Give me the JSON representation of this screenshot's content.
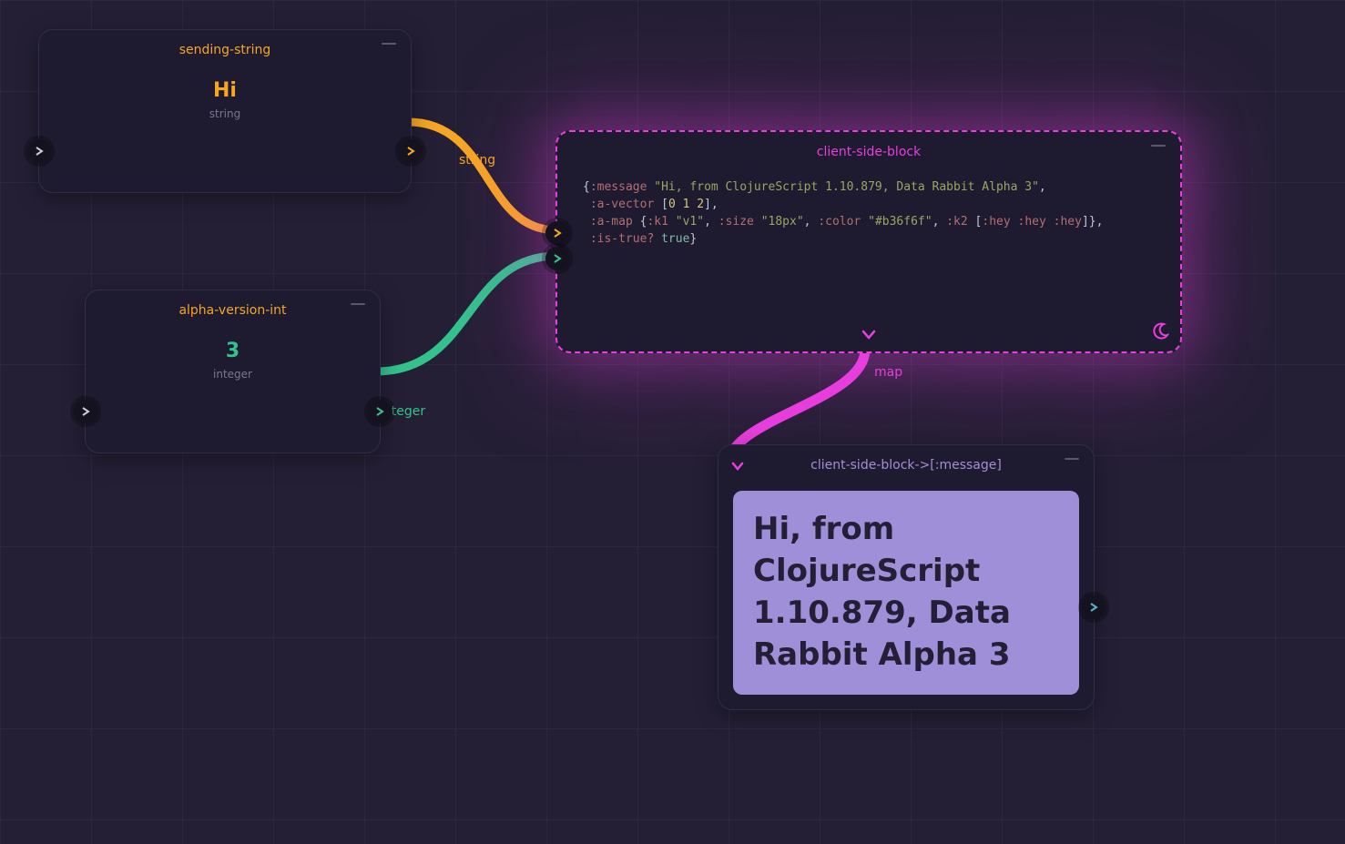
{
  "nodes": {
    "sending_string": {
      "title": "sending-string",
      "value": "Hi",
      "type_label": "string"
    },
    "alpha_version_int": {
      "title": "alpha-version-int",
      "value": "3",
      "type_label": "integer"
    },
    "client_side_block": {
      "title": "client-side-block",
      "code_tokens": [
        [
          [
            "cp",
            "{"
          ],
          [
            "ck",
            ":message"
          ],
          [
            "cp",
            " "
          ],
          [
            "cs",
            "\"Hi, from ClojureScript 1.10.879, Data Rabbit Alpha 3\""
          ],
          [
            "cp",
            ","
          ]
        ],
        [
          [
            "cp",
            " "
          ],
          [
            "ck",
            ":a-vector"
          ],
          [
            "cp",
            " ["
          ],
          [
            "cn",
            "0"
          ],
          [
            "cp",
            " "
          ],
          [
            "cn",
            "1"
          ],
          [
            "cp",
            " "
          ],
          [
            "cn",
            "2"
          ],
          [
            "cp",
            "],"
          ]
        ],
        [
          [
            "cp",
            " "
          ],
          [
            "ck",
            ":a-map"
          ],
          [
            "cp",
            " {"
          ],
          [
            "ck",
            ":k1"
          ],
          [
            "cp",
            " "
          ],
          [
            "cs",
            "\"v1\""
          ],
          [
            "cp",
            ", "
          ],
          [
            "ck",
            ":size"
          ],
          [
            "cp",
            " "
          ],
          [
            "cs",
            "\"18px\""
          ],
          [
            "cp",
            ", "
          ],
          [
            "ck",
            ":color"
          ],
          [
            "cp",
            " "
          ],
          [
            "cs",
            "\"#b36f6f\""
          ],
          [
            "cp",
            ", "
          ],
          [
            "ck",
            ":k2"
          ],
          [
            "cp",
            " ["
          ],
          [
            "ck",
            ":hey"
          ],
          [
            "cp",
            " "
          ],
          [
            "ck",
            ":hey"
          ],
          [
            "cp",
            " "
          ],
          [
            "ck",
            ":hey"
          ],
          [
            "cp",
            "]}"
          ],
          [
            "cp",
            ","
          ]
        ],
        [
          [
            "cp",
            " "
          ],
          [
            "ck",
            ":is-true?"
          ],
          [
            "cp",
            " "
          ],
          [
            "cb",
            "true"
          ],
          [
            "cp",
            "}"
          ]
        ]
      ]
    },
    "message_out": {
      "title": "client-side-block->[:message]",
      "body": "Hi, from ClojureScript 1.10.879, Data Rabbit Alpha 3"
    }
  },
  "wire_labels": {
    "string": "string",
    "integer": "integer",
    "map": "map"
  },
  "colors": {
    "orange": "#f6a623",
    "green": "#34c28c",
    "magenta": "#e83fdd"
  }
}
